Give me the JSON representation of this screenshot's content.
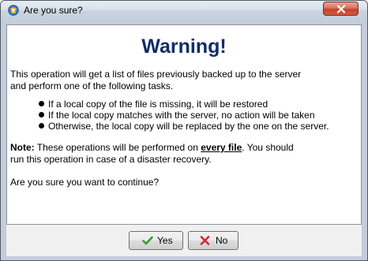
{
  "window": {
    "title": "Are you sure?",
    "close_label": "Close"
  },
  "dialog": {
    "heading": "Warning!",
    "intro_lines": [
      "This operation will get a list of files previously backed up to the server",
      "and perform one of the following tasks."
    ],
    "bullets": [
      "If a local copy of the file is missing, it will be restored",
      "If the local copy matches with the server, no action will be taken",
      "Otherwise, the local copy will be replaced by the one on the server."
    ],
    "note_label": "Note:",
    "note_before": " These operations will be performed on ",
    "note_emphasis": "every file",
    "note_after": ". You should",
    "note_line2": "run this operation in case of a disaster recovery.",
    "question": "Are you sure you want to continue?"
  },
  "buttons": {
    "yes_label": "Yes",
    "no_label": "No"
  },
  "colors": {
    "heading": "#102d68",
    "yes_icon": "#2ea12e",
    "no_icon": "#d42a2a"
  },
  "icons": {
    "app": "app-globe-icon",
    "close": "close-x-icon",
    "yes": "checkmark-icon",
    "no": "cross-icon"
  }
}
